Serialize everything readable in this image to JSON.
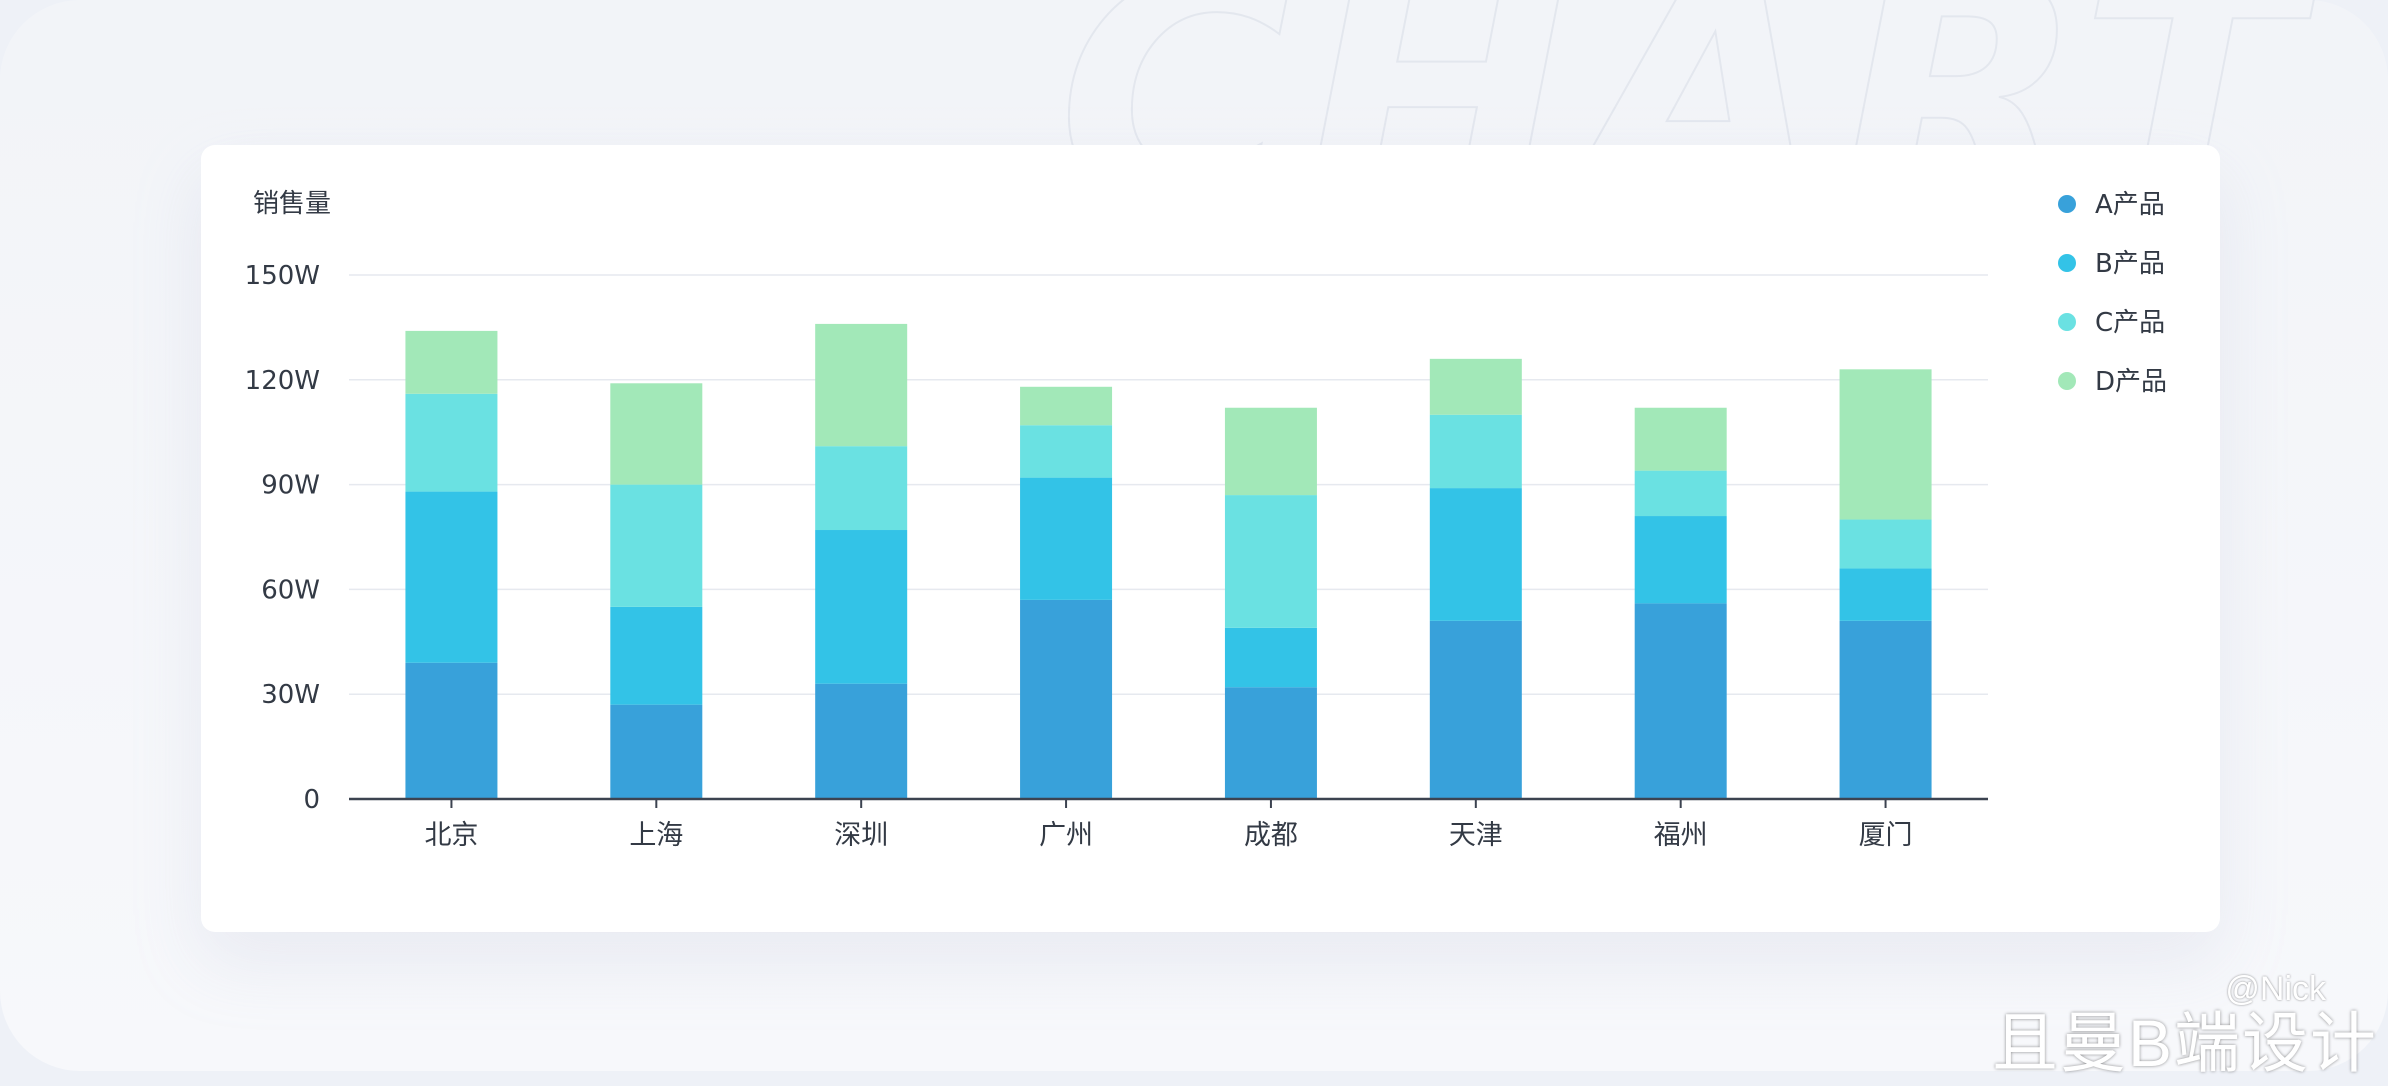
{
  "chart_data": {
    "type": "bar",
    "stacked": true,
    "ylabel": "销售量",
    "ylim": [
      0,
      150
    ],
    "y_ticks": [
      "0",
      "30W",
      "60W",
      "90W",
      "120W",
      "150W"
    ],
    "categories": [
      "北京",
      "上海",
      "深圳",
      "广州",
      "成都",
      "天津",
      "福州",
      "厦门"
    ],
    "series": [
      {
        "name": "A产品",
        "color": "#38a1da",
        "values": [
          39,
          27,
          33,
          57,
          32,
          51,
          56,
          51
        ]
      },
      {
        "name": "B产品",
        "color": "#33c3e7",
        "values": [
          49,
          28,
          44,
          35,
          17,
          38,
          25,
          15
        ]
      },
      {
        "name": "C产品",
        "color": "#6ae1e2",
        "values": [
          28,
          35,
          24,
          15,
          38,
          21,
          13,
          14
        ]
      },
      {
        "name": "D产品",
        "color": "#a2e8b8",
        "values": [
          18,
          29,
          35,
          11,
          25,
          16,
          18,
          43
        ]
      }
    ],
    "legend_position": "top-right",
    "grid": true
  },
  "credit": {
    "handle": "@Nick",
    "name": "且曼B端设计"
  }
}
